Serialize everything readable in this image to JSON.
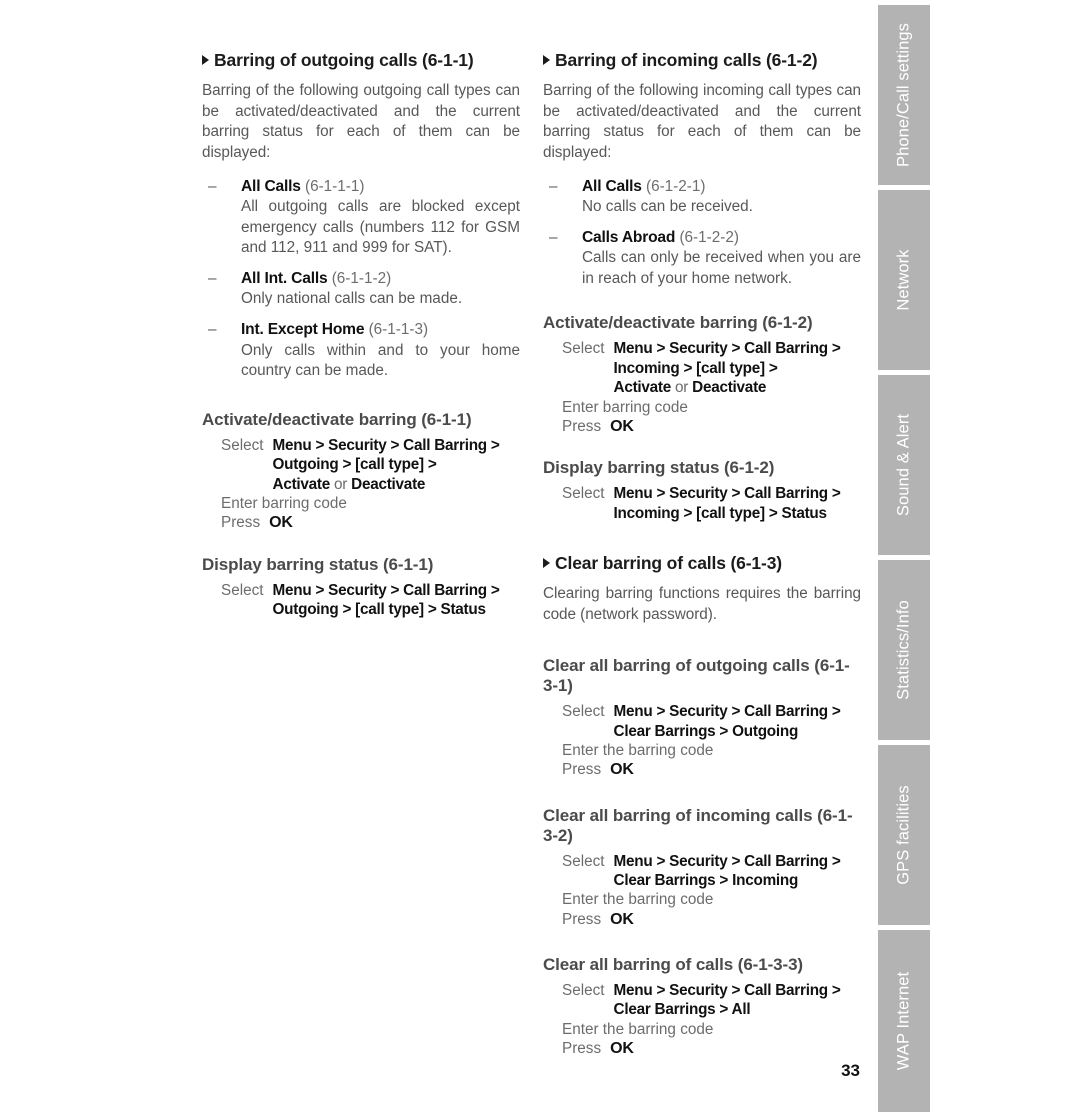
{
  "document": {
    "page_number": "33",
    "colors": {
      "tab_background": "#b3b3b3",
      "tab_text": "#ffffff",
      "heading_main": "#1c1c1c",
      "heading_sub": "#4b4b4d",
      "body_text": "#58585a",
      "bold_term": "#111111"
    }
  },
  "tabs": [
    {
      "label": "Phone/Call settings"
    },
    {
      "label": "Network"
    },
    {
      "label": "Sound & Alert"
    },
    {
      "label": "Statistics/Info"
    },
    {
      "label": "GPS facilities"
    },
    {
      "label": "WAP Internet"
    }
  ],
  "left_column": {
    "section_heading": "Barring of outgoing calls (6-1-1)",
    "intro": "Barring of the following outgoing call types can be activated/deactivated and the current barring status for each of them can be displayed:",
    "items": [
      {
        "term": "All Calls",
        "code": "(6-1-1-1)",
        "desc": "All outgoing calls are blocked except emergency calls (numbers 112 for GSM and 112, 911 and 999 for SAT)."
      },
      {
        "term": "All Int. Calls",
        "code": "(6-1-1-2)",
        "desc": "Only national calls can be made."
      },
      {
        "term": "Int. Except Home",
        "code": "(6-1-1-3)",
        "desc": "Only calls within and to your home country can be made."
      }
    ],
    "activate": {
      "heading": "Activate/deactivate barring (6-1-1)",
      "select_label": "Select",
      "path_line1": "Menu > Security > Call Barring >",
      "path_line2": "Outgoing > [call type] >",
      "path_line3_a": "Activate",
      "path_line3_or": "or",
      "path_line3_b": "Deactivate",
      "enter_line": "Enter barring code",
      "press_label": "Press",
      "press_key": "OK"
    },
    "status": {
      "heading": "Display barring status (6-1-1)",
      "select_label": "Select",
      "path_line1": "Menu > Security > Call Barring >",
      "path_line2": "Outgoing > [call type] > Status"
    }
  },
  "right_column": {
    "section_heading": "Barring of incoming calls (6-1-2)",
    "intro": "Barring of the following incoming call types can be activated/deactivated and the current barring status for each of them can be displayed:",
    "items": [
      {
        "term": "All Calls",
        "code": "(6-1-2-1)",
        "desc": "No calls can be received."
      },
      {
        "term": "Calls Abroad",
        "code": "(6-1-2-2)",
        "desc": "Calls can only be received when you are in reach of your home network."
      }
    ],
    "activate": {
      "heading": "Activate/deactivate barring (6-1-2)",
      "select_label": "Select",
      "path_line1": "Menu > Security > Call Barring >",
      "path_line2": "Incoming > [call type] >",
      "path_line3_a": "Activate",
      "path_line3_or": "or",
      "path_line3_b": "Deactivate",
      "enter_line": "Enter barring code",
      "press_label": "Press",
      "press_key": "OK"
    },
    "status": {
      "heading": "Display barring status (6-1-2)",
      "select_label": "Select",
      "path_line1": "Menu > Security > Call Barring >",
      "path_line2": "Incoming > [call type] > Status"
    },
    "clear_section": {
      "heading": "Clear barring of calls (6-1-3)",
      "intro": "Clearing barring functions requires the barring code (network password)."
    },
    "clear_outgoing": {
      "heading": "Clear all barring of outgoing calls (6-1-3-1)",
      "select_label": "Select",
      "path_line1": "Menu > Security > Call Barring >",
      "path_line2": "Clear Barrings > Outgoing",
      "enter_line": "Enter the barring code",
      "press_label": "Press",
      "press_key": "OK"
    },
    "clear_incoming": {
      "heading": "Clear all barring of incoming calls (6-1-3-2)",
      "select_label": "Select",
      "path_line1": "Menu > Security > Call Barring >",
      "path_line2": "Clear Barrings > Incoming",
      "enter_line": "Enter the barring code",
      "press_label": "Press",
      "press_key": "OK"
    },
    "clear_all": {
      "heading": "Clear all barring of calls (6-1-3-3)",
      "select_label": "Select",
      "path_line1": "Menu > Security > Call Barring >",
      "path_line2": "Clear Barrings > All",
      "enter_line": "Enter the barring code",
      "press_label": "Press",
      "press_key": "OK"
    }
  }
}
